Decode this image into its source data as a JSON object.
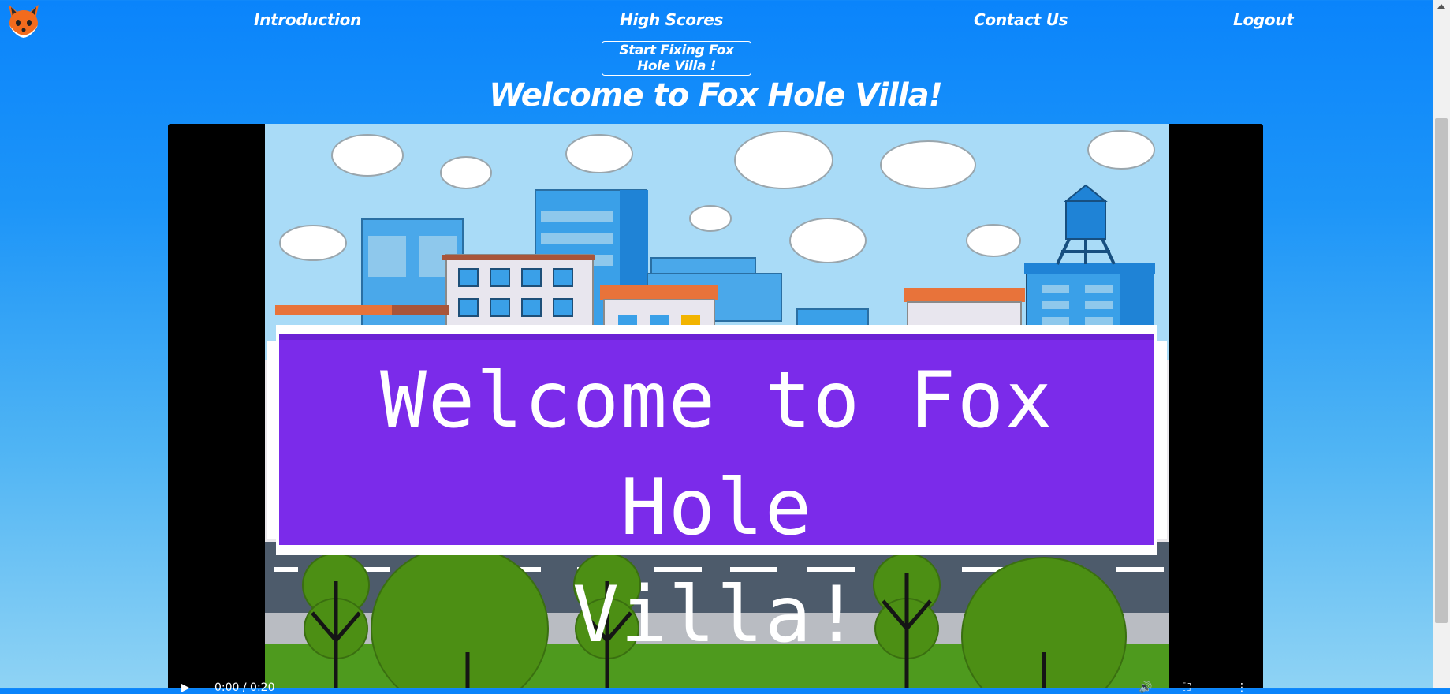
{
  "nav": {
    "logo_icon": "fox-logo-icon",
    "links": [
      "Introduction",
      "High Scores",
      "Contact Us",
      "Logout"
    ]
  },
  "cta_label": "Start Fixing Fox Hole Villa !",
  "heading": "Welcome to Fox Hole Villa!",
  "video": {
    "banner_line1": "Welcome to Fox Hole",
    "banner_line2": "Villa!",
    "time": "0:00 / 0:20"
  },
  "colors": {
    "background": "#0a84fb",
    "banner": "#7b2bea",
    "sky": "#a9dbf7"
  }
}
